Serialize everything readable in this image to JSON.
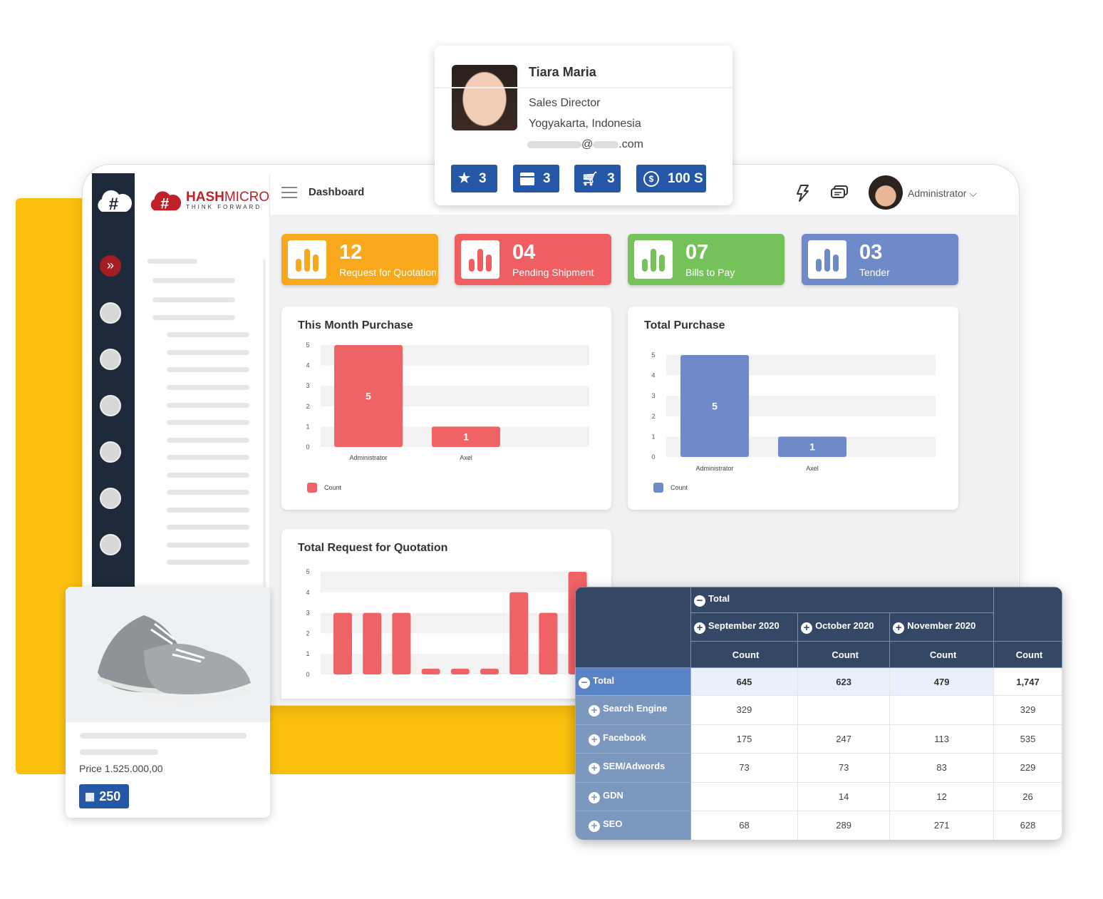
{
  "profile": {
    "name": "Tiara Maria",
    "title": "Sales Director",
    "location": "Yogyakarta, Indonesia",
    "email_at": "@",
    "email_domain_suffix": ".com",
    "badges": [
      {
        "icon": "star-icon",
        "value": "3"
      },
      {
        "icon": "calendar-icon",
        "value": "3"
      },
      {
        "icon": "cart-icon",
        "value": "3"
      },
      {
        "icon": "coin-icon",
        "value": "100 S"
      }
    ]
  },
  "brand": {
    "name_bold": "HASH",
    "name_rest": "MICRO",
    "tagline": "THINK FORWARD",
    "color": "#c0202a"
  },
  "header": {
    "title": "Dashboard",
    "user": "Administrator"
  },
  "kpis": [
    {
      "value": "12",
      "label": "Request for Quotation",
      "color": "#f7a81b"
    },
    {
      "value": "04",
      "label": "Pending Shipment",
      "color": "#ef5f62"
    },
    {
      "value": "07",
      "label": "Bills to Pay",
      "color": "#76c25a"
    },
    {
      "value": "03",
      "label": "Tender",
      "color": "#6f8ac8"
    }
  ],
  "chart_data": [
    {
      "type": "bar",
      "title": "This Month Purchase",
      "categories": [
        "Administrator",
        "Axel"
      ],
      "values": [
        5,
        1
      ],
      "ylim": [
        0,
        5
      ],
      "yticks": [
        0,
        1,
        2,
        3,
        4,
        5
      ],
      "legend": "Count",
      "color": "#ef6266",
      "data_labels": true
    },
    {
      "type": "bar",
      "title": "Total Purchase",
      "categories": [
        "Administrator",
        "Axel"
      ],
      "values": [
        5,
        1
      ],
      "ylim": [
        0,
        5
      ],
      "yticks": [
        0,
        1,
        2,
        3,
        4,
        5
      ],
      "legend": "Count",
      "color": "#6f8ac8",
      "data_labels": true
    },
    {
      "type": "bar",
      "title": "Total Request for Quotation",
      "categories": [],
      "values": [
        3,
        3,
        3,
        0,
        0,
        0,
        4,
        3,
        5
      ],
      "ylim": [
        0,
        5
      ],
      "yticks": [
        0,
        1,
        2,
        3,
        4,
        5
      ],
      "color": "#ef6266",
      "data_labels": false
    }
  ],
  "product": {
    "price": "Price 1.525.000,00",
    "stock": "250"
  },
  "pivot": {
    "top": "Total",
    "months": [
      "September 2020",
      "October 2020",
      "November 2020"
    ],
    "measure": "Count",
    "rows": [
      {
        "label": "Total",
        "values": [
          "645",
          "623",
          "479",
          "1,747"
        ]
      },
      {
        "label": "Search Engine",
        "values": [
          "329",
          "",
          "",
          "329"
        ]
      },
      {
        "label": "Facebook",
        "values": [
          "175",
          "247",
          "113",
          "535"
        ]
      },
      {
        "label": "SEM/Adwords",
        "values": [
          "73",
          "73",
          "83",
          "229"
        ]
      },
      {
        "label": "GDN",
        "values": [
          "",
          "14",
          "12",
          "26"
        ]
      },
      {
        "label": "SEO",
        "values": [
          "68",
          "289",
          "271",
          "628"
        ]
      }
    ]
  }
}
